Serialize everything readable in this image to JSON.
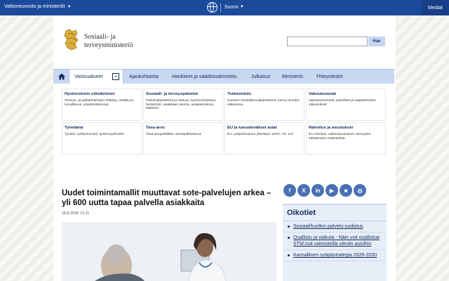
{
  "topbar": {
    "gov_link": "Valtioneuvosto ja ministeriöt",
    "language": "Suomi",
    "media": "Mediat"
  },
  "header": {
    "logo_line1": "Sosiaali- ja",
    "logo_line2": "terveysministeriö",
    "search_placeholder": "",
    "search_button": "Hae"
  },
  "nav": {
    "items": [
      "Vastuualueet",
      "Ajankohtaista",
      "Hankkeet ja säädösvalmistelu",
      "Julkaisut",
      "Ministeriö",
      "Yhteystiedot"
    ],
    "toggle_symbol": "–"
  },
  "mega": [
    {
      "title": "Hyvinvoinnin edistäminen",
      "desc": "Terveys- ja päihdehaittojen ehkäisy, osallisuus, turvallisuus, ympäristöterveys"
    },
    {
      "title": "Sosiaali- ja terveyspalvelut",
      "desc": "Palvelujärjestelmä ja vastuut, hyvinvointialueet, henkilöstö, asiakkaan asema, asiakasmaksut, lääkkeet"
    },
    {
      "title": "Toimeentulo",
      "desc": "Suomen sosiaaliturvajärjestelmä, tuet ja etuudet, eläketurva"
    },
    {
      "title": "Vakuutusasiat",
      "desc": "Vakuutustoiminta, pakolliset ja vapaaehtoiset vakuutukset"
    },
    {
      "title": "Työelämä",
      "desc": "Työolot, työhyvinvointi, työterveyshuolto"
    },
    {
      "title": "Tasa-arvo",
      "desc": "Tasa-arvopolitiikka, samapalkkaisuus"
    },
    {
      "title": "EU ja kansainväliset asiat",
      "desc": "EU, pohjoismainen yhteistyö, WHO, YK, ILO"
    },
    {
      "title": "Rahoitus ja avustukset",
      "desc": "EU-rahoitus, valtionavustukset, terveyden edistämisen määrärahat"
    }
  ],
  "article": {
    "headline": "Uudet toimintamallit muuttavat sote-palvelujen arkea – yli 600 uutta tapaa palvella asiakkaita",
    "date": "18.8.2026 13.11"
  },
  "social": [
    "f",
    "X",
    "in",
    "▶",
    "■",
    "◎"
  ],
  "shortcuts": {
    "title": "Oikotiet",
    "items": [
      "Sosiaalihuollon palvelu-uudistus",
      "Osallistu ja vaikuta - Näin voit osallistua STM:ssä valmisteilla oleviin asioihin",
      "Kansallinen syöpästrategia 2026-2030"
    ]
  },
  "colors": {
    "topbar": "#1b4a9b",
    "nav": "#c9d8f1",
    "accent": "#142c5c"
  }
}
